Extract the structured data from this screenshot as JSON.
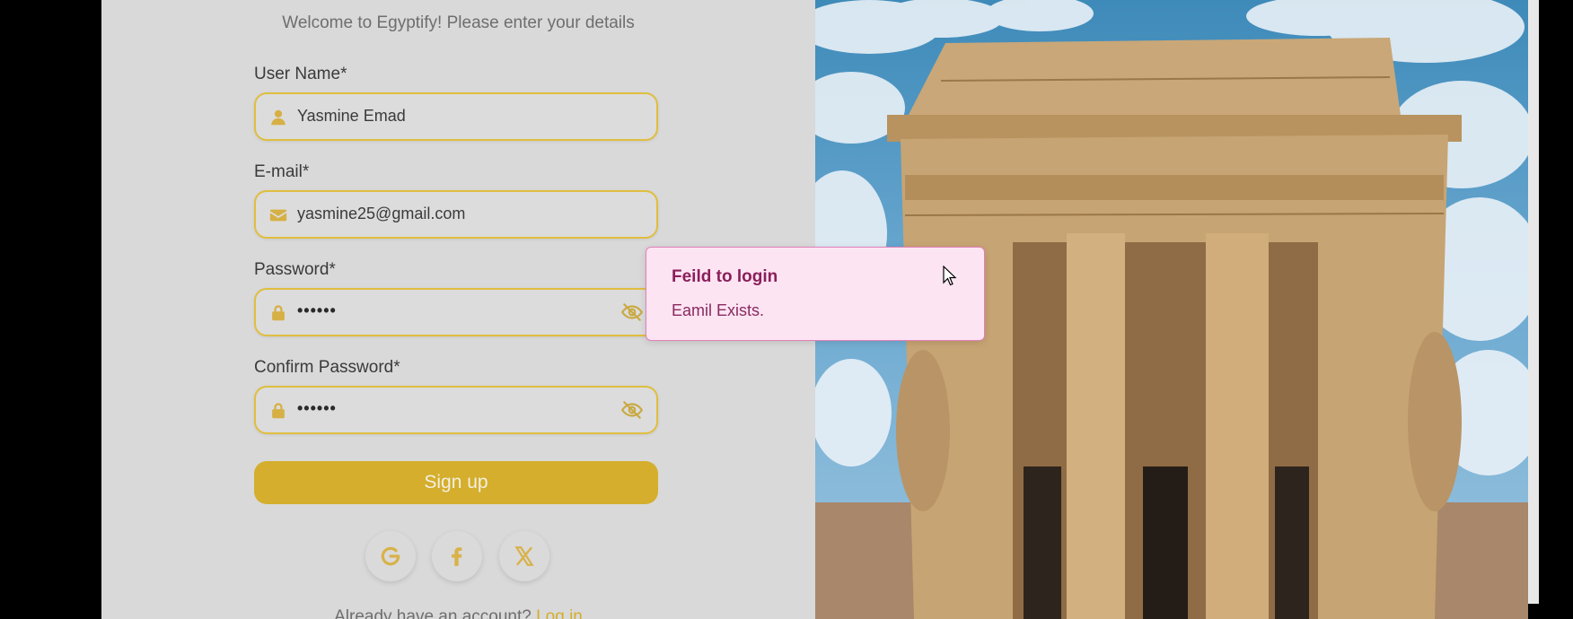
{
  "form": {
    "welcome_text": "Welcome to Egyptify! Please enter your details",
    "username": {
      "label": "User Name*",
      "value": "Yasmine Emad",
      "icon": "user-icon"
    },
    "email": {
      "label": "E-mail*",
      "value": "yasmine25@gmail.com",
      "icon": "envelope-icon"
    },
    "password": {
      "label": "Password*",
      "value": "••••••",
      "icon": "lock-icon",
      "toggle_icon": "eye-slash-icon"
    },
    "confirm_password": {
      "label": "Confirm Password*",
      "value": "••••••",
      "icon": "lock-icon",
      "toggle_icon": "eye-slash-icon"
    },
    "signup_label": "Sign up",
    "social": [
      "google-icon",
      "facebook-icon",
      "x-icon"
    ],
    "already_text": "Already have an account?",
    "login_link": "Log in"
  },
  "toast": {
    "title": "Feild to login",
    "message": "Eamil Exists."
  },
  "colors": {
    "accent": "#d4ae2c",
    "panel": "#d9d9d9",
    "toast_bg": "#fde4f3",
    "toast_border": "#e080b8",
    "toast_text": "#8a1f5a"
  }
}
